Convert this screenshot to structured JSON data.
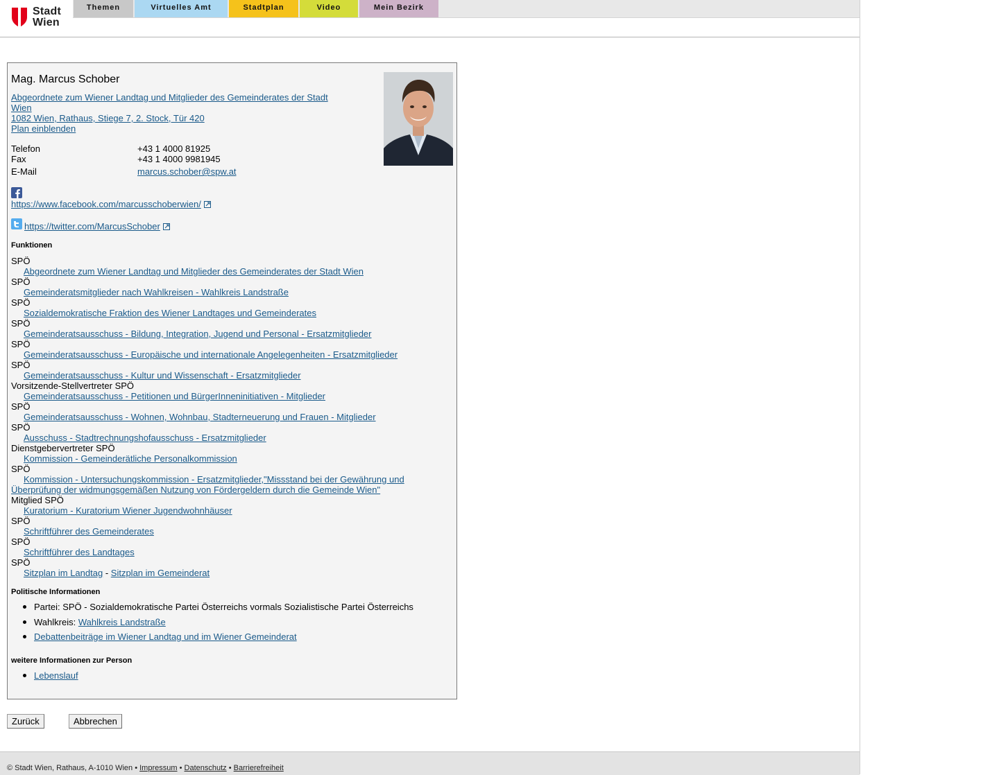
{
  "header": {
    "logo_line1": "Stadt",
    "logo_line2": "Wien",
    "tabs": [
      {
        "label": "Themen",
        "color": "#c8c8c8"
      },
      {
        "label": "Virtuelles Amt",
        "color": "#abd8f2"
      },
      {
        "label": "Stadtplan",
        "color": "#f5c21b"
      },
      {
        "label": "Video",
        "color": "#d4dc3a"
      },
      {
        "label": "Mein Bezirk",
        "color": "#cdb2c8"
      }
    ]
  },
  "person": {
    "name": "Mag. Marcus Schober",
    "title_line1": "Abgeordnete zum Wiener Landtag und Mitglieder des Gemeinderates der Stadt",
    "title_line2": "Wien ",
    "address": "1082 Wien, Rathaus, Stiege 7, 2. Stock, Tür 420",
    "plan_link": "Plan einblenden",
    "photo_icon": "portrait-photo",
    "contact": {
      "phone_label": "Telefon",
      "phone": "+43 1 4000 81925",
      "fax_label": "Fax",
      "fax": "+43 1 4000 9981945",
      "email_label": "E-Mail",
      "email": "marcus.schober@spw.at"
    },
    "facebook_icon": "facebook-icon",
    "facebook_url": "https://www.facebook.com/marcusschoberwien/",
    "twitter_icon": "twitter-icon",
    "twitter_url": "https://twitter.com/MarcusSchober"
  },
  "functions": {
    "heading": "Funktionen",
    "items": [
      {
        "role": "SPÖ",
        "link": "Abgeordnete zum Wiener Landtag und Mitglieder des Gemeinderates der Stadt Wien"
      },
      {
        "role": "SPÖ",
        "link": "Gemeinderatsmitglieder nach Wahlkreisen - Wahlkreis Landstraße"
      },
      {
        "role": "SPÖ",
        "link": "Sozialdemokratische Fraktion des Wiener Landtages und Gemeinderates"
      },
      {
        "role": "SPÖ",
        "link": "Gemeinderatsausschuss - Bildung, Integration, Jugend und Personal - Ersatzmitglieder"
      },
      {
        "role": "SPÖ",
        "link": "Gemeinderatsausschuss - Europäische und internationale Angelegenheiten - Ersatzmitglieder"
      },
      {
        "role": "SPÖ",
        "link": "Gemeinderatsausschuss - Kultur und Wissenschaft - Ersatzmitglieder"
      },
      {
        "role": "Vorsitzende-Stellvertreter SPÖ",
        "link": "Gemeinderatsausschuss - Petitionen und BürgerInneninitiativen - Mitglieder"
      },
      {
        "role": "SPÖ",
        "link": "Gemeinderatsausschuss - Wohnen, Wohnbau, Stadterneuerung und Frauen - Mitglieder"
      },
      {
        "role": "SPÖ",
        "link": "Ausschuss - Stadtrechnungshofausschuss - Ersatzmitglieder"
      },
      {
        "role": "Dienstgebervertreter SPÖ",
        "link": "Kommission - Gemeinderätliche Personalkommission"
      },
      {
        "role": "SPÖ",
        "link": "Kommission - Untersuchungskommission - Ersatzmitglieder,\"Missstand bei der Gewährung und",
        "link_cont": "Überprüfung der widmungsgemäßen Nutzung von Fördergeldern durch die Gemeinde Wien\""
      },
      {
        "role": "Mitglied SPÖ",
        "link": "Kuratorium - Kuratorium Wiener Jugendwohnhäuser"
      },
      {
        "role": "SPÖ",
        "link": "Schriftführer des Gemeinderates"
      },
      {
        "role": "SPÖ",
        "link": "Schriftführer des Landtages"
      },
      {
        "role": "SPÖ",
        "link": "Sitzplan im Landtag",
        "separator": "-",
        "link2": "Sitzplan im Gemeinderat"
      }
    ]
  },
  "political": {
    "heading": "Politische Informationen",
    "party_label": "Partei:",
    "party": "SPÖ - Sozialdemokratische Partei Österreichs vormals Sozialistische Partei Österreichs",
    "district_label": "Wahlkreis:",
    "district_link": "Wahlkreis Landstraße",
    "debates_link": "Debattenbeiträge im Wiener Landtag und im Wiener Gemeinderat"
  },
  "more": {
    "heading": "weitere Informationen zur Person",
    "cv_link": "Lebenslauf"
  },
  "buttons": {
    "back": "Zurück",
    "cancel": "Abbrechen"
  },
  "footer": {
    "copyright": "© Stadt Wien, Rathaus, A-1010 Wien",
    "sep": "•",
    "impressum": "Impressum",
    "datenschutz": "Datenschutz",
    "barrierefreiheit": "Barrierefreiheit"
  }
}
